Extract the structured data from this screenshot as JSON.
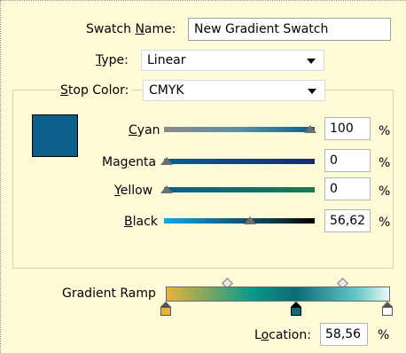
{
  "swatch_name": {
    "label": "Swatch Name:",
    "value": "New Gradient Swatch"
  },
  "type": {
    "label": "Type:",
    "value": "Linear"
  },
  "stop_color": {
    "label": "Stop Color:",
    "mode": "CMYK",
    "swatch_color": "#0c5f8a"
  },
  "sliders": [
    {
      "label": "Cyan",
      "value": "100",
      "unit": "%",
      "position": 1.0
    },
    {
      "label": "Magenta",
      "value": "0",
      "unit": "%",
      "position": 0.0
    },
    {
      "label": "Yellow",
      "value": "0",
      "unit": "%",
      "position": 0.0
    },
    {
      "label": "Black",
      "value": "56,62",
      "unit": "%",
      "position": 0.5662
    }
  ],
  "gradient_ramp": {
    "label": "Gradient Ramp",
    "stops": [
      {
        "color": "#e7b33a",
        "location": 0,
        "selected": false
      },
      {
        "color": "#0c6b76",
        "location": 58.56,
        "selected": true
      },
      {
        "color": "#ffffff",
        "location": 100,
        "selected": false
      }
    ],
    "midpoints": [
      29,
      79
    ],
    "location_label": "Location:",
    "location_value": "58,56",
    "location_unit": "%"
  }
}
